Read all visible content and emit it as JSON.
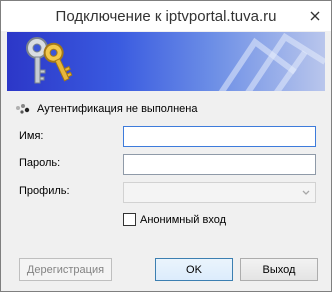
{
  "window": {
    "title": "Подключение к iptvportal.tuva.ru"
  },
  "banner": {
    "icon": "keys-icon"
  },
  "status": {
    "icon": "loading-dots-icon",
    "text": "Аутентификация не выполнена"
  },
  "form": {
    "name_label": "Имя:",
    "name_value": "",
    "password_label": "Пароль:",
    "password_value": "",
    "profile_label": "Профиль:",
    "profile_value": "",
    "anonymous_label": "Анонимный вход",
    "anonymous_checked": false
  },
  "buttons": {
    "register": "Дерегистрация",
    "ok": "OK",
    "exit": "Выход"
  },
  "colors": {
    "banner_left": "#2c37c8",
    "banner_right": "#b9c6ec",
    "focus_border": "#3d7bdb"
  }
}
